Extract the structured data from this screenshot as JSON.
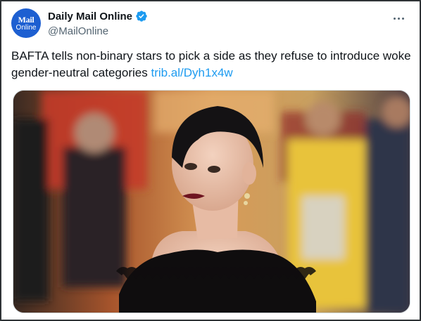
{
  "account": {
    "display_name": "Daily Mail Online",
    "handle": "@MailOnline",
    "avatar_text_line1": "Mail",
    "avatar_text_line2": "Online",
    "verified": true,
    "verified_color": "#1d9bf0"
  },
  "tweet": {
    "text": "BAFTA tells non-binary stars to pick a side as they refuse to introduce woke gender-neutral categories",
    "link": "trib.al/Dyh1x4w"
  },
  "media": {
    "kind": "photo"
  },
  "icons": {
    "more": "more-horizontal-icon",
    "verified": "verified-badge-icon"
  },
  "colors": {
    "text": "#0f1419",
    "secondary": "#536471",
    "link": "#1d9bf0",
    "avatar_bg": "#1d5fd1"
  }
}
